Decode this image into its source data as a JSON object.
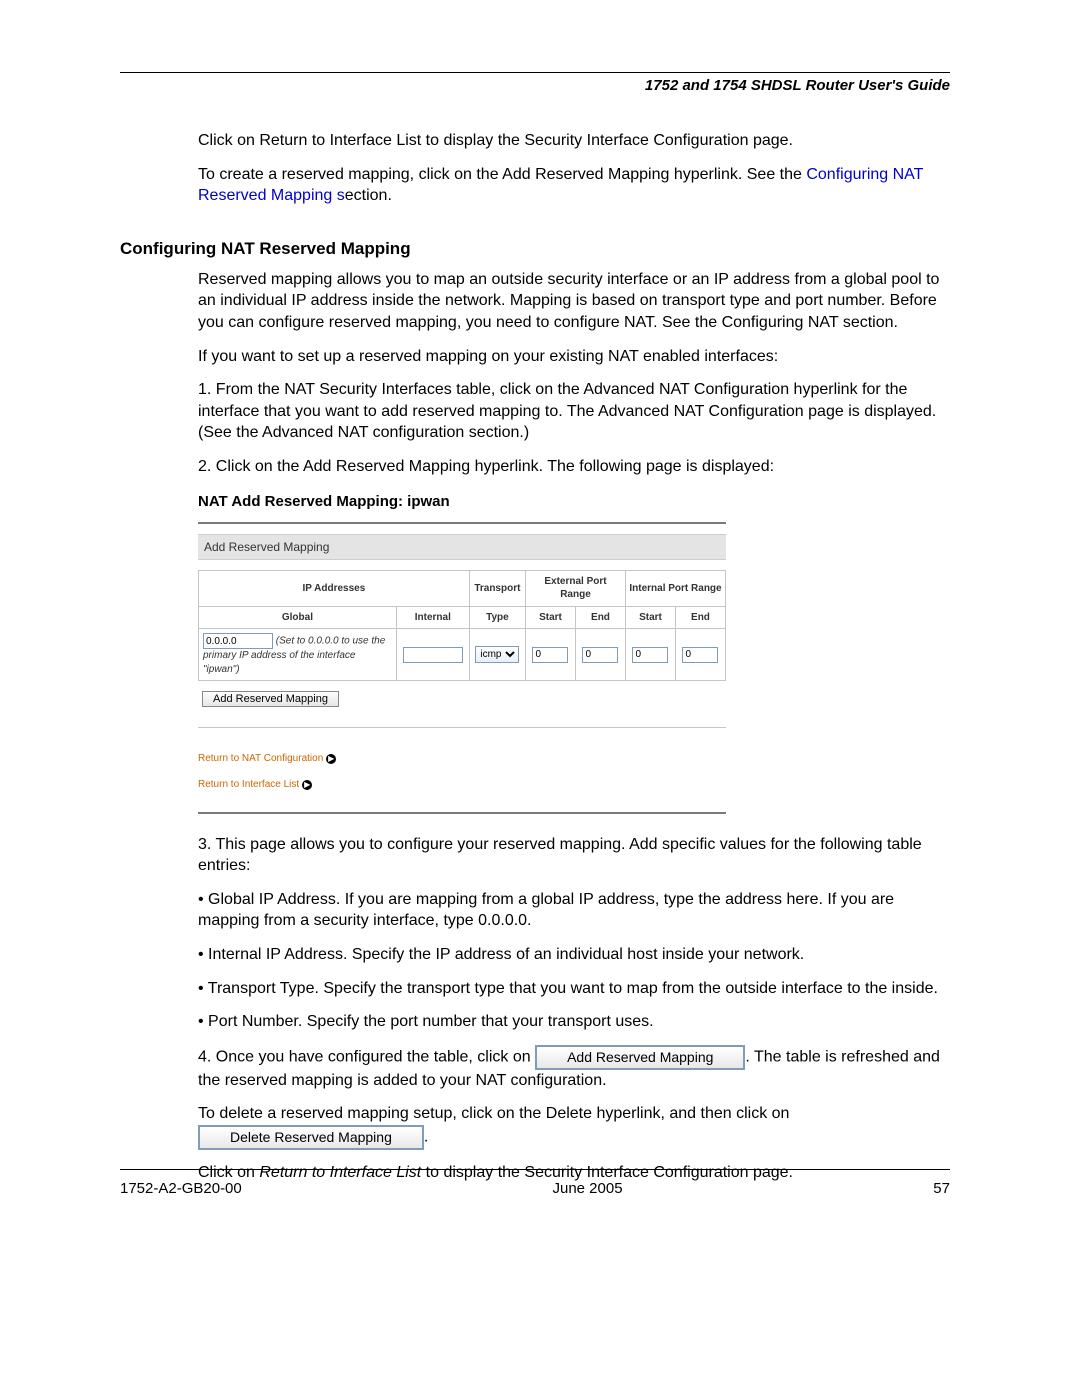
{
  "header": {
    "guide_title": "1752 and 1754 SHDSL Router User's Guide"
  },
  "intro": {
    "p1": "Click on Return to Interface List to display the Security Interface Configuration page.",
    "p2": "To create a reserved mapping, click on the Add Reserved Mapping hyperlink. See the ",
    "p2_link": "Configuring NAT Reserved Mapping s",
    "p2_tail": "ection."
  },
  "section": {
    "heading": "Configuring NAT Reserved Mapping",
    "p1": "Reserved mapping allows you to map an outside security interface or an IP address from a global pool to an individual IP address inside the network. Mapping is based on transport type and port number. Before you can configure reserved mapping, you need to configure NAT. See the Configuring NAT section.",
    "p2": "If you want to set up a reserved mapping on your existing NAT enabled interfaces:",
    "step1": "1. From the NAT Security Interfaces table, click on the Advanced NAT Configuration hyperlink for the interface that you want to add reserved mapping to. The Advanced NAT Configuration page is displayed.  (See the Advanced NAT configuration section.)",
    "step2": "2. Click on the Add Reserved Mapping hyperlink. The following page is displayed:"
  },
  "screenshot": {
    "title": "NAT Add Reserved Mapping: ipwan",
    "panel_header": "Add Reserved Mapping",
    "headers": {
      "ip": "IP Addresses",
      "transport": "Transport",
      "ext_range": "External Port Range",
      "int_range": "Internal Port Range",
      "global": "Global",
      "internal": "Internal",
      "type": "Type",
      "start": "Start",
      "end": "End"
    },
    "row": {
      "global_ip": "0.0.0.0",
      "global_hint": "(Set to 0.0.0.0 to use the primary IP address of the interface \"ipwan\")",
      "internal_ip": "",
      "transport_value": "icmp",
      "ext_start": "0",
      "ext_end": "0",
      "int_start": "0",
      "int_end": "0"
    },
    "button_add": "Add Reserved Mapping",
    "link_nat": "Return to NAT Configuration",
    "link_iface": "Return to Interface List"
  },
  "after": {
    "step3": "3. This page allows you to configure your reserved mapping. Add specific values for the following table entries:",
    "b1": "• Global IP Address. If you are mapping from a global IP address, type the address here. If you are mapping from a security interface, type 0.0.0.0.",
    "b2": "• Internal IP Address. Specify the IP address of an individual host inside your network.",
    "b3": "• Transport Type. Specify the transport type that you want to map from the outside interface to the inside.",
    "b4": "• Port Number. Specify the port number that your transport uses.",
    "step4_a": "4. Once you have configured the table, click on ",
    "step4_btn": "Add Reserved Mapping",
    "step4_b": ". The table is refreshed and the reserved mapping is added to your NAT configuration.",
    "delete_a": "To delete a reserved mapping setup, click on the Delete hyperlink, and then click on ",
    "delete_btn": "Delete Reserved Mapping",
    "delete_b": ".",
    "return_a": "Click on ",
    "return_it": "Return to Interface List",
    "return_b": " to display the Security Interface Configuration page."
  },
  "footer": {
    "left": "1752-A2-GB20-00",
    "center": "June 2005",
    "right": "57"
  }
}
